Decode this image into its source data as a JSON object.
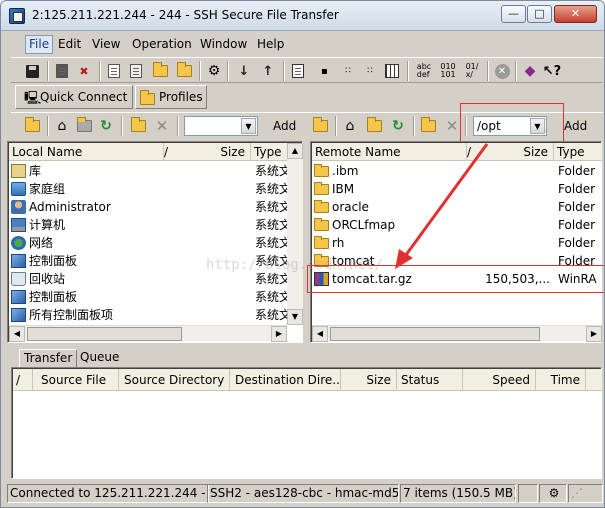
{
  "window": {
    "title": "2:125.211.221.244 - 244 - SSH Secure File Transfer",
    "minimize_icon": "minimize-icon",
    "maximize_icon": "maximize-icon",
    "close_icon": "close-icon"
  },
  "menu": [
    "File",
    "Edit",
    "View",
    "Operation",
    "Window",
    "Help"
  ],
  "toolbar2": {
    "quick_connect": "Quick Connect",
    "profiles": "Profiles"
  },
  "local": {
    "add_label": "Add",
    "path": "",
    "columns": {
      "name": "Local Name",
      "slash": "/",
      "size": "Size",
      "type": "Type"
    },
    "items": [
      {
        "icon": "library-icon",
        "name": "库",
        "size": "",
        "type": "系统文"
      },
      {
        "icon": "homegroup-icon",
        "name": "家庭组",
        "size": "",
        "type": "系统文"
      },
      {
        "icon": "user-icon",
        "name": "Administrator",
        "size": "",
        "type": "系统文"
      },
      {
        "icon": "computer-icon",
        "name": "计算机",
        "size": "",
        "type": "系统文"
      },
      {
        "icon": "network-icon",
        "name": "网络",
        "size": "",
        "type": "系统文"
      },
      {
        "icon": "control-panel-icon",
        "name": "控制面板",
        "size": "",
        "type": "系统文"
      },
      {
        "icon": "recycle-bin-icon",
        "name": "回收站",
        "size": "",
        "type": "系统文"
      },
      {
        "icon": "control-panel-icon",
        "name": "控制面板",
        "size": "",
        "type": "系统文"
      },
      {
        "icon": "control-panel-icon",
        "name": "所有控制面板项",
        "size": "",
        "type": "系统文"
      }
    ]
  },
  "remote": {
    "add_label": "Add",
    "path": "/opt",
    "columns": {
      "name": "Remote Name",
      "slash": "/",
      "size": "Size",
      "type": "Type"
    },
    "items": [
      {
        "icon": "folder-icon",
        "name": ".ibm",
        "size": "",
        "type": "Folder"
      },
      {
        "icon": "folder-icon",
        "name": "IBM",
        "size": "",
        "type": "Folder"
      },
      {
        "icon": "folder-icon",
        "name": "oracle",
        "size": "",
        "type": "Folder"
      },
      {
        "icon": "folder-icon",
        "name": "ORCLfmap",
        "size": "",
        "type": "Folder"
      },
      {
        "icon": "folder-icon",
        "name": "rh",
        "size": "",
        "type": "Folder"
      },
      {
        "icon": "folder-icon",
        "name": "tomcat",
        "size": "",
        "type": "Folder"
      },
      {
        "icon": "archive-icon",
        "name": "tomcat.tar.gz",
        "size": "150,503,...",
        "type": "WinRA"
      }
    ]
  },
  "transfer": {
    "tabs": [
      "Transfer",
      "Queue"
    ],
    "columns": [
      "/",
      "Source File",
      "Source Directory",
      "Destination Dire...",
      "Size",
      "Status",
      "Speed",
      "Time"
    ]
  },
  "statusbar": {
    "connection": "Connected to 125.211.221.244 - /",
    "cipher": "SSH2 - aes128-cbc - hmac-md5",
    "items": "7 items (150.5 MB)"
  },
  "watermark": "http://blog.csdn.net/",
  "colors": {
    "callout": "#e03030",
    "accent": "#1a3a8a"
  }
}
